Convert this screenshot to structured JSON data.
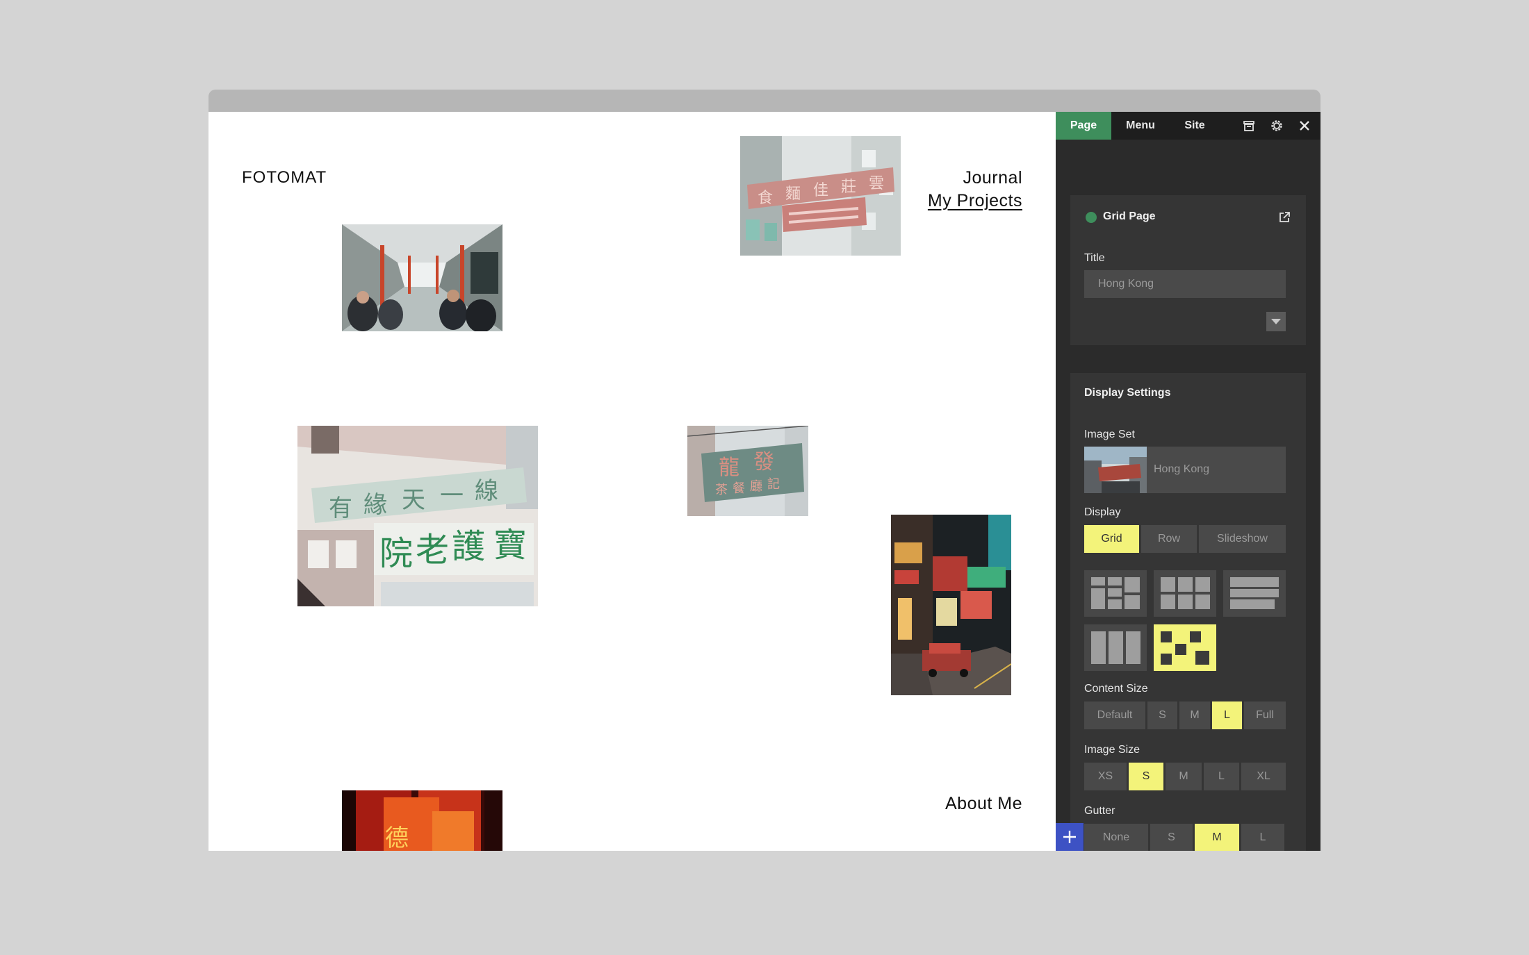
{
  "site": {
    "logo": "FOTOMAT",
    "nav": {
      "journal": "Journal",
      "projects": "My Projects",
      "about": "About Me"
    }
  },
  "panel": {
    "tabs": [
      "Page",
      "Menu",
      "Site"
    ],
    "page_card": {
      "status_color": "#3e8e5c",
      "page_type": "Grid Page",
      "title_label": "Title",
      "title_value": "Hong Kong"
    },
    "display": {
      "heading": "Display Settings",
      "image_set_label": "Image Set",
      "image_set_value": "Hong Kong",
      "display_label": "Display",
      "display_options": [
        "Grid",
        "Row",
        "Slideshow"
      ],
      "display_selected": "Grid",
      "layouts": [
        "mixed-grid",
        "even-grid",
        "rows",
        "columns",
        "scattered"
      ],
      "layout_selected": "scattered",
      "content_size_label": "Content Size",
      "content_size_options": [
        "Default",
        "S",
        "M",
        "L",
        "Full"
      ],
      "content_size_selected": "L",
      "image_size_label": "Image Size",
      "image_size_options": [
        "XS",
        "S",
        "M",
        "L",
        "XL"
      ],
      "image_size_selected": "S",
      "gutter_label": "Gutter",
      "gutter_options": [
        "None",
        "S",
        "M",
        "L"
      ],
      "gutter_selected": "M"
    }
  },
  "colors": {
    "accent_green": "#3e8e5c",
    "highlight_yellow": "#f3f37a",
    "add_button_blue": "#3d52c4"
  }
}
